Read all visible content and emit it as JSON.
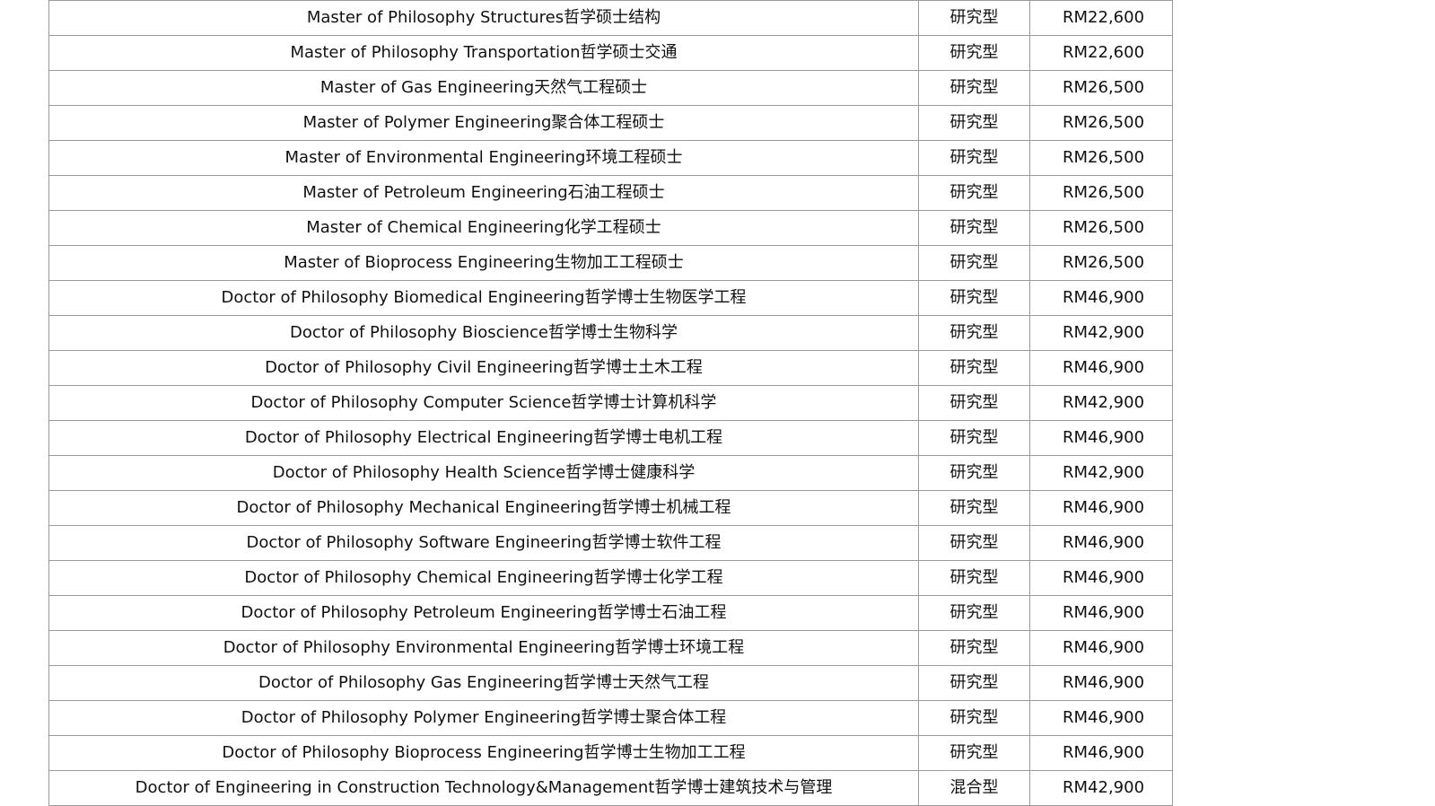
{
  "table": {
    "rows": [
      {
        "program": "Master of Philosophy Structures哲学硕士结构",
        "type": "研究型",
        "fee": "RM22,600"
      },
      {
        "program": "Master of Philosophy Transportation哲学硕士交通",
        "type": "研究型",
        "fee": "RM22,600"
      },
      {
        "program": "Master of Gas Engineering天然气工程硕士",
        "type": "研究型",
        "fee": "RM26,500"
      },
      {
        "program": "Master of Polymer Engineering聚合体工程硕士",
        "type": "研究型",
        "fee": "RM26,500"
      },
      {
        "program": "Master of Environmental Engineering环境工程硕士",
        "type": "研究型",
        "fee": "RM26,500"
      },
      {
        "program": "Master of Petroleum Engineering石油工程硕士",
        "type": "研究型",
        "fee": "RM26,500"
      },
      {
        "program": "Master of Chemical Engineering化学工程硕士",
        "type": "研究型",
        "fee": "RM26,500"
      },
      {
        "program": "Master of Bioprocess Engineering生物加工工程硕士",
        "type": "研究型",
        "fee": "RM26,500"
      },
      {
        "program": "Doctor of Philosophy Biomedical Engineering哲学博士生物医学工程",
        "type": "研究型",
        "fee": "RM46,900"
      },
      {
        "program": "Doctor of Philosophy Bioscience哲学博士生物科学",
        "type": "研究型",
        "fee": "RM42,900"
      },
      {
        "program": "Doctor of Philosophy Civil Engineering哲学博士土木工程",
        "type": "研究型",
        "fee": "RM46,900"
      },
      {
        "program": "Doctor of Philosophy Computer Science哲学博士计算机科学",
        "type": "研究型",
        "fee": "RM42,900"
      },
      {
        "program": "Doctor of Philosophy Electrical Engineering哲学博士电机工程",
        "type": "研究型",
        "fee": "RM46,900"
      },
      {
        "program": "Doctor of Philosophy Health Science哲学博士健康科学",
        "type": "研究型",
        "fee": "RM42,900"
      },
      {
        "program": "Doctor of Philosophy Mechanical Engineering哲学博士机械工程",
        "type": "研究型",
        "fee": "RM46,900"
      },
      {
        "program": "Doctor of Philosophy Software Engineering哲学博士软件工程",
        "type": "研究型",
        "fee": "RM46,900"
      },
      {
        "program": "Doctor of Philosophy Chemical Engineering哲学博士化学工程",
        "type": "研究型",
        "fee": "RM46,900"
      },
      {
        "program": "Doctor of Philosophy Petroleum Engineering哲学博士石油工程",
        "type": "研究型",
        "fee": "RM46,900"
      },
      {
        "program": "Doctor of Philosophy Environmental Engineering哲学博士环境工程",
        "type": "研究型",
        "fee": "RM46,900"
      },
      {
        "program": "Doctor of Philosophy Gas Engineering哲学博士天然气工程",
        "type": "研究型",
        "fee": "RM46,900"
      },
      {
        "program": "Doctor of Philosophy Polymer Engineering哲学博士聚合体工程",
        "type": "研究型",
        "fee": "RM46,900"
      },
      {
        "program": "Doctor of Philosophy Bioprocess Engineering哲学博士生物加工工程",
        "type": "研究型",
        "fee": "RM46,900"
      },
      {
        "program": "Doctor of Engineering in Construction Technology&Management哲学博士建筑技术与管理",
        "type": "混合型",
        "fee": "RM42,900"
      }
    ]
  }
}
